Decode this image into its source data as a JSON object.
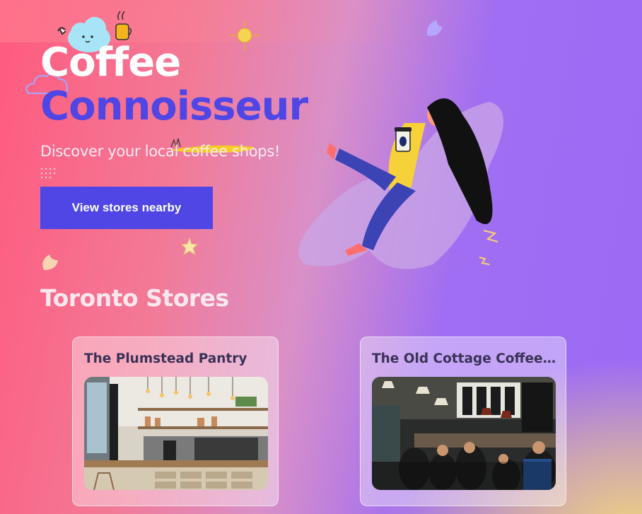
{
  "hero": {
    "title_line1": "Coffee",
    "title_line2": "Connoisseur",
    "subtitle": "Discover your local coffee shops!",
    "cta_label": "View stores nearby"
  },
  "section": {
    "title": "Toronto Stores"
  },
  "stores": [
    {
      "name": "The Plumstead Pantry",
      "image": "cafe-counter-photo"
    },
    {
      "name": "The Old Cottage Coffee Shop",
      "image": "busy-cafe-interior-photo"
    }
  ],
  "colors": {
    "accent": "#4f46e5",
    "bg_left": "#ff5a7e",
    "bg_right": "#9b6af5",
    "bg_corner": "#f3d47c"
  }
}
